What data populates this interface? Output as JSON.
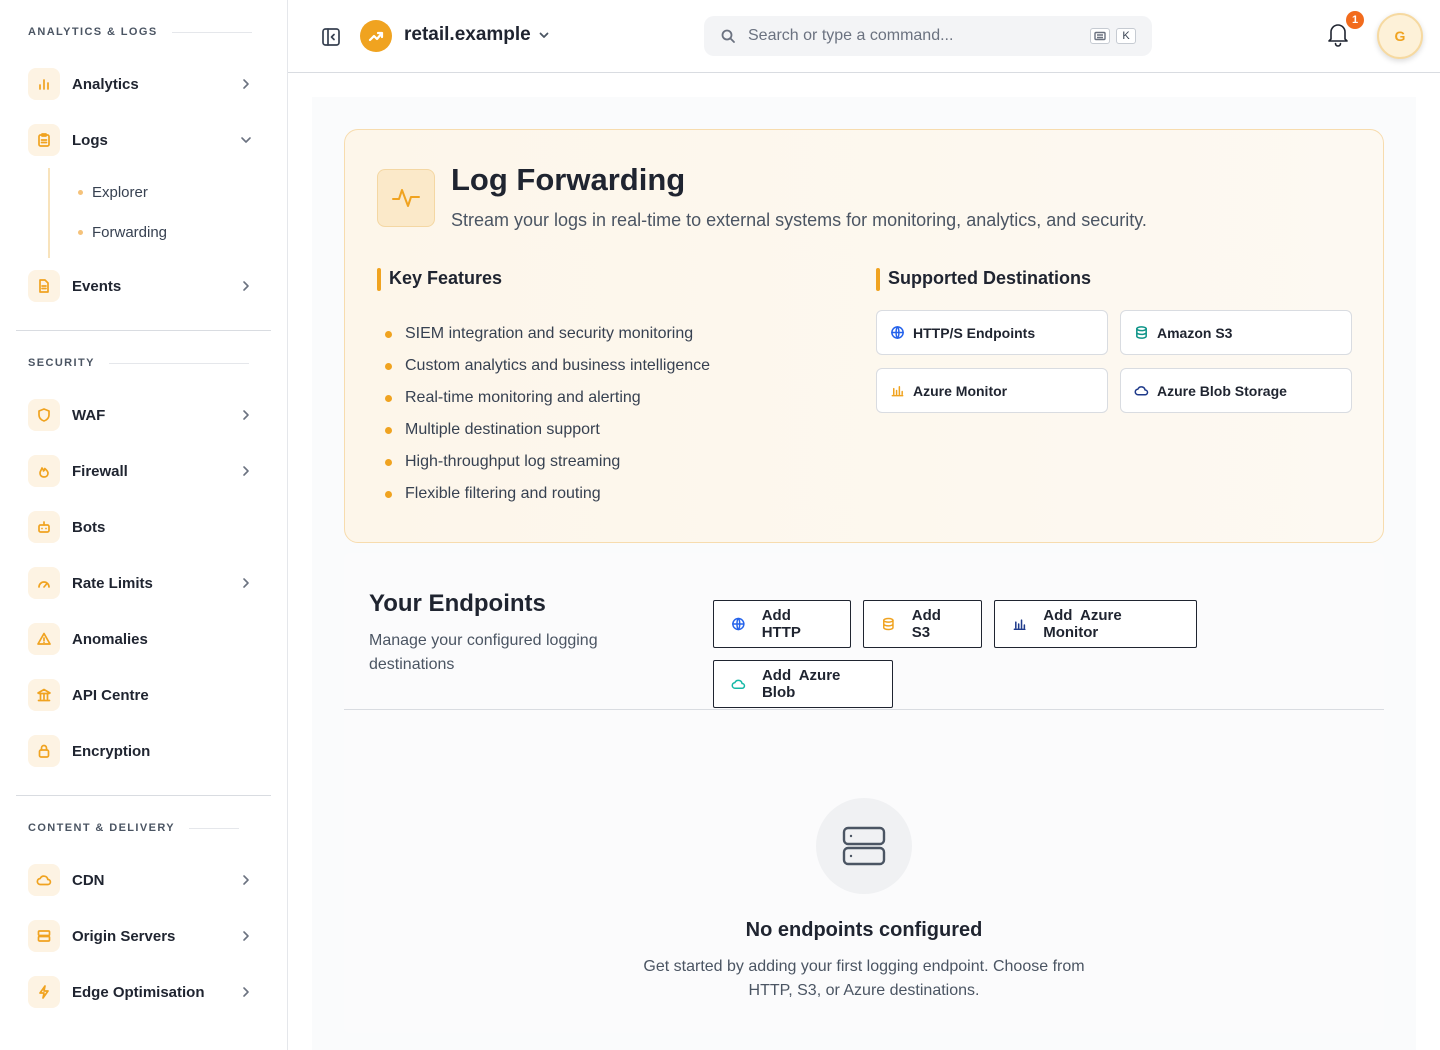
{
  "sidebar": {
    "sections": [
      {
        "title": "ANALYTICS & LOGS"
      },
      {
        "title": "SECURITY"
      },
      {
        "title": "CONTENT & DELIVERY"
      }
    ],
    "analytics": "Analytics",
    "logs": "Logs",
    "logs_sub": [
      "Explorer",
      "Forwarding"
    ],
    "events": "Events",
    "security_items": [
      "WAF",
      "Firewall",
      "Bots",
      "Rate Limits",
      "Anomalies",
      "API Centre",
      "Encryption"
    ],
    "content_items": [
      "CDN",
      "Origin Servers",
      "Edge Optimisation"
    ]
  },
  "header": {
    "site_name": "retail.example",
    "search_placeholder": "Search or type a command...",
    "shortcut_key": "K",
    "notification_count": "1",
    "avatar_initial": "G"
  },
  "hero": {
    "title": "Log Forwarding",
    "subtitle": "Stream your logs in real-time to external systems for monitoring, analytics, and security.",
    "features_heading": "Key Features",
    "features": [
      "SIEM integration and security monitoring",
      "Custom analytics and business intelligence",
      "Real-time monitoring and alerting",
      "Multiple destination support",
      "High-throughput log streaming",
      "Flexible filtering and routing"
    ],
    "destinations_heading": "Supported Destinations",
    "destinations": [
      "HTTP/S Endpoints",
      "Amazon S3",
      "Azure Monitor",
      "Azure Blob Storage"
    ]
  },
  "endpoints": {
    "title": "Your Endpoints",
    "subtitle": "Manage your configured logging destinations",
    "buttons": [
      "Add HTTP",
      "Add S3",
      "Add Azure Monitor",
      "Add Azure Blob"
    ],
    "empty_title": "No endpoints configured",
    "empty_text": "Get started by adding your first logging endpoint. Choose from HTTP, S3, or Azure destinations."
  },
  "colors": {
    "accent": "#f0a320",
    "http_icon": "#2563eb",
    "s3_icon": "#0d9488",
    "azure_monitor_icon": "#f0a320",
    "azure_blob_icon": "#1e3a8a"
  }
}
